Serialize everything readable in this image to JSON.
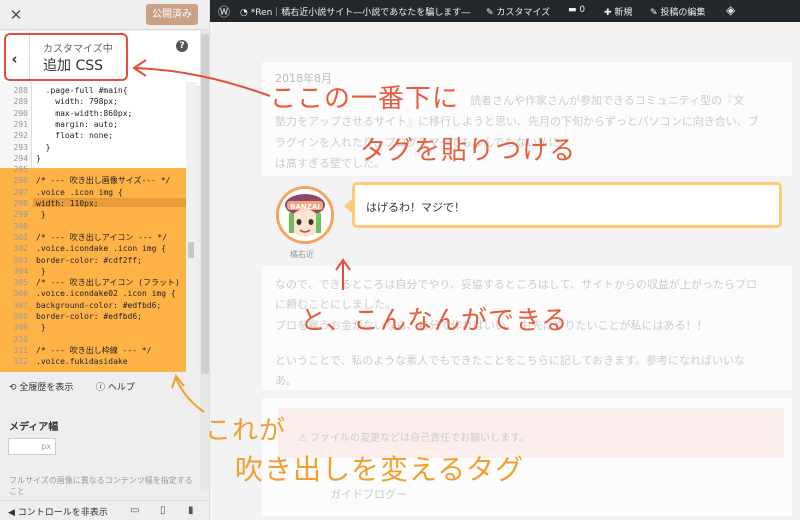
{
  "panel": {
    "close_label": "✕",
    "publish_label": "公開済み",
    "back_label": "‹",
    "breadcrumb": "カスタマイズ中",
    "section_title": "追加 CSS",
    "help_icon": "?",
    "code_lines": [
      {
        "n": "288",
        "t": "  .page-full #main{"
      },
      {
        "n": "289",
        "t": "    width: 798px;"
      },
      {
        "n": "290",
        "t": "    max-width:860px;"
      },
      {
        "n": "291",
        "t": "    margin: auto;"
      },
      {
        "n": "292",
        "t": "    float: none;"
      },
      {
        "n": "293",
        "t": "  }"
      },
      {
        "n": "294",
        "t": "}"
      },
      {
        "n": "295",
        "t": ""
      },
      {
        "n": "296",
        "t": "/* --- 吹き出し画像サイズ--- */"
      },
      {
        "n": "297",
        "t": ".voice .icon img {"
      },
      {
        "n": "298",
        "t": "width: 110px;"
      },
      {
        "n": "299",
        "t": " }"
      },
      {
        "n": "300",
        "t": ""
      },
      {
        "n": "301",
        "t": "/* --- 吹き出しアイコン --- */"
      },
      {
        "n": "302",
        "t": ".voice.icondake .icon img {"
      },
      {
        "n": "303",
        "t": "border-color: #cdf2ff;"
      },
      {
        "n": "304",
        "t": " }"
      },
      {
        "n": "305",
        "t": "/* --- 吹き出しアイコン (フラット)  --- */"
      },
      {
        "n": "306",
        "t": ".voice.icondake02 .icon img {"
      },
      {
        "n": "307",
        "t": "background-color: #edfbd6;"
      },
      {
        "n": "308",
        "t": "border-color: #edfbd6;"
      },
      {
        "n": "309",
        "t": " }"
      },
      {
        "n": "310",
        "t": ""
      },
      {
        "n": "311",
        "t": "/* --- 吹き出し枠線 --- */"
      },
      {
        "n": "312",
        "t": ".voice.fukidasidake"
      }
    ],
    "history_label": "全履歴を表示",
    "help_label": "ヘルプ",
    "media_label": "メディア幅",
    "media_placeholder": "px",
    "media_desc": "フルサイズの画像に異なるコンテンツ幅を指定すること",
    "hide_controls_label": "コントロールを非表示",
    "colors": {
      "publish": "#c9a184",
      "highlight": "#ffb347",
      "annotation_red": "#e74c3c"
    }
  },
  "adminbar": {
    "wp_icon": "wordpress-icon",
    "site_title": "*Ren｜橘右近小説サイト―小説であなたを騙します―",
    "customize_label": "カスタマイズ",
    "comment_count": "0",
    "new_label": "新規",
    "edit_label": "投稿の編集"
  },
  "preview": {
    "date": "2018年8月",
    "faint_lines": [
      "読者さんや作家さんが参加できるコミュニティ型の『文",
      "塾力をアップさせるサイト』に移行しようと思い、先月の下旬からずっとパソコンに向き合い、ブ",
      "ラグインを入れたり、プログラマーでもなんでもない私に",
      "は高すぎる壁でした。"
    ],
    "bubble_text": "はげるわ！マジで！",
    "avatar_name": "橘右近",
    "avatar_caption": "BANZAI",
    "faint_lines_2": [
      "なので、できるところは自分でやり、妥協するところはして、サイトからの収益が上がったらプロ",
      "に頼むことにしました。",
      "プロを雇うお金がないなら、自分で作ればいい。                 も先にやりたいことが私にはある！！",
      "ということで、私のような素人でもできたことをこちらに記しておきます。参考になればいいな",
      "あ。"
    ],
    "warning_text": "⚠ ファイルの変更などは自己責任でお願いします。",
    "faint_bottom": "ガイドブログー"
  },
  "annotations": {
    "line1": "ここの一番下に",
    "line2": "タグを貼りつける",
    "line3": "と、こんなんができる",
    "line4": "これが",
    "line5": "吹き出しを変えるタグ"
  }
}
